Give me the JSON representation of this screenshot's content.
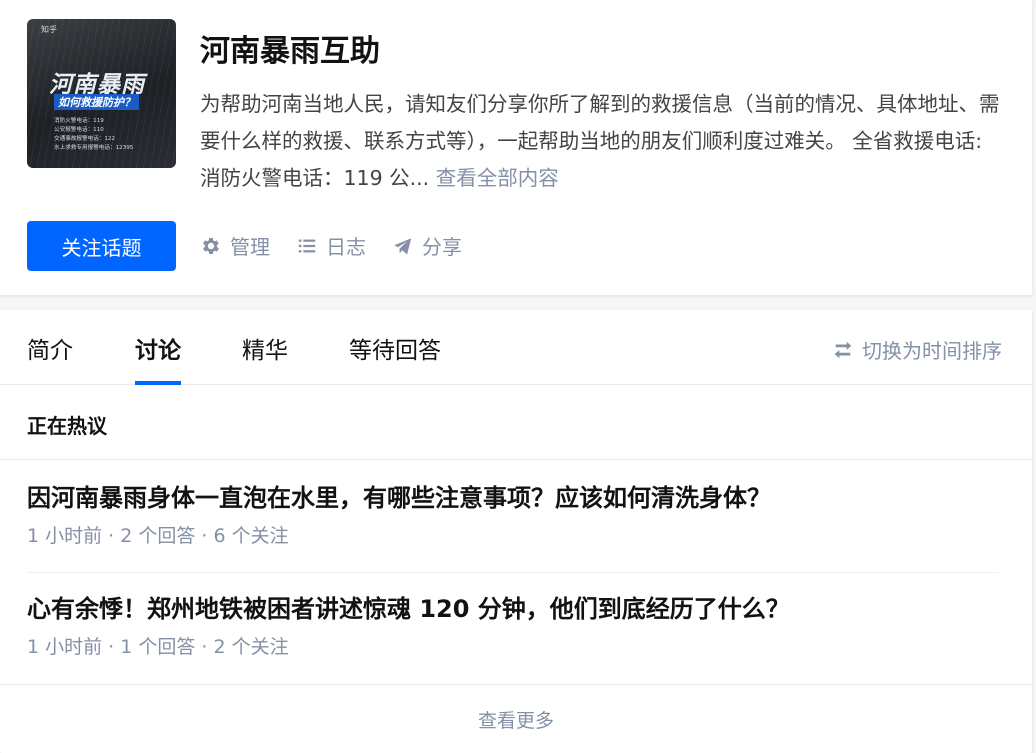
{
  "topic": {
    "cover": {
      "logo_text": "知乎",
      "title": "河南暴雨",
      "subtitle": "如何救援防护？",
      "lines": [
        "消防火警电话：119",
        "公安报警电话：110",
        "交通事故报警电话：122",
        "水上求救专用报警电话：12395"
      ]
    },
    "title": "河南暴雨互助",
    "description": "为帮助河南当地人民，请知友们分享你所了解到的救援信息（当前的情况、具体地址、需要什么样的救援、联系方式等），一起帮助当地的朋友们顺利度过难关。 全省救援电话: 消防火警电话：119 公...",
    "more_link": "查看全部内容",
    "follow_label": "关注话题",
    "actions": {
      "manage": "管理",
      "log": "日志",
      "share": "分享"
    },
    "colors": {
      "primary": "#0066ff",
      "muted": "#8590a6"
    }
  },
  "feed": {
    "tabs": [
      {
        "label": "简介",
        "active": false
      },
      {
        "label": "讨论",
        "active": true
      },
      {
        "label": "精华",
        "active": false
      },
      {
        "label": "等待回答",
        "active": false
      }
    ],
    "sort_label": "切换为时间排序",
    "section_title": "正在热议",
    "questions": [
      {
        "title": "因河南暴雨身体一直泡在水里，有哪些注意事项？应该如何清洗身体？",
        "meta": "1 小时前 · 2 个回答 · 6 个关注"
      },
      {
        "title": "心有余悸！郑州地铁被困者讲述惊魂 120 分钟，他们到底经历了什么？",
        "meta": "1 小时前 · 1 个回答 · 2 个关注"
      }
    ],
    "view_more": "查看更多"
  }
}
